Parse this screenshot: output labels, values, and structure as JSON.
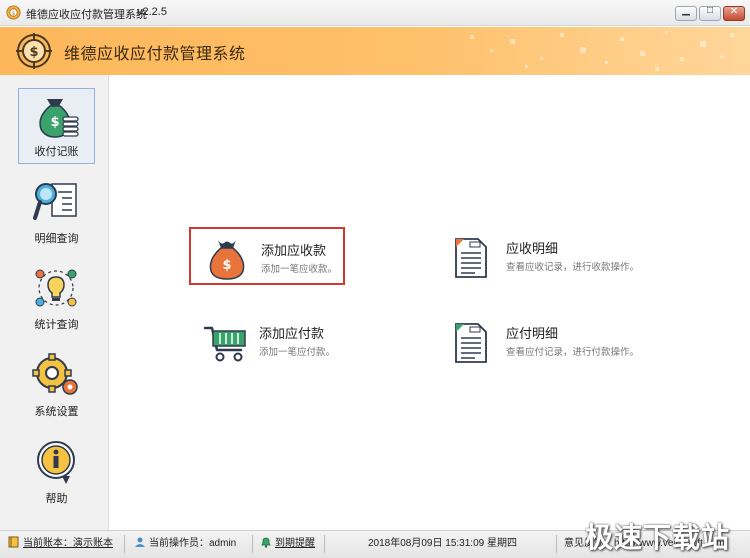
{
  "window": {
    "title": "维德应收应付款管理系统",
    "version": "v2.2.5",
    "minimize_glyph": "▁",
    "maximize_glyph": "□",
    "close_glyph": "✕"
  },
  "header": {
    "title": "维德应收应付款管理系统",
    "accent": "#fdb75a"
  },
  "sidebar": {
    "items": [
      {
        "label": "收付记账",
        "icon": "money-bag-icon",
        "active": true
      },
      {
        "label": "明细查询",
        "icon": "magnifier-document-icon",
        "active": false
      },
      {
        "label": "统计查询",
        "icon": "lightbulb-cycle-icon",
        "active": false
      },
      {
        "label": "系统设置",
        "icon": "gear-icon",
        "active": false
      },
      {
        "label": "帮助",
        "icon": "info-icon",
        "active": false
      }
    ]
  },
  "actions": [
    {
      "title": "添加应收款",
      "desc": "添加一笔应收款。",
      "icon": "money-bag-icon",
      "highlight": true
    },
    {
      "title": "添加应付款",
      "desc": "添加一笔应付款。",
      "icon": "shopping-cart-icon",
      "highlight": false
    },
    {
      "title": "应收明细",
      "desc": "查看应收记录，进行收款操作。",
      "icon": "document-icon",
      "highlight": false
    },
    {
      "title": "应付明细",
      "desc": "查看应付记录，进行付款操作。",
      "icon": "document-icon",
      "highlight": false
    }
  ],
  "statusbar": {
    "account": "当前账本：演示账本",
    "operator": "当前操作员：admin",
    "reminder": "到期提醒",
    "datetime": "2018年08月09日  15:31:09 星期四",
    "feedback": "意见反馈：http://www.veidosoft.com"
  },
  "watermark": "极速下载站",
  "colors": {
    "highlight_border": "#d33a2f",
    "active_border": "#8db2e3",
    "icon_green": "#3aa36b",
    "icon_orange": "#e8743b",
    "icon_dark": "#2e3b4e"
  }
}
